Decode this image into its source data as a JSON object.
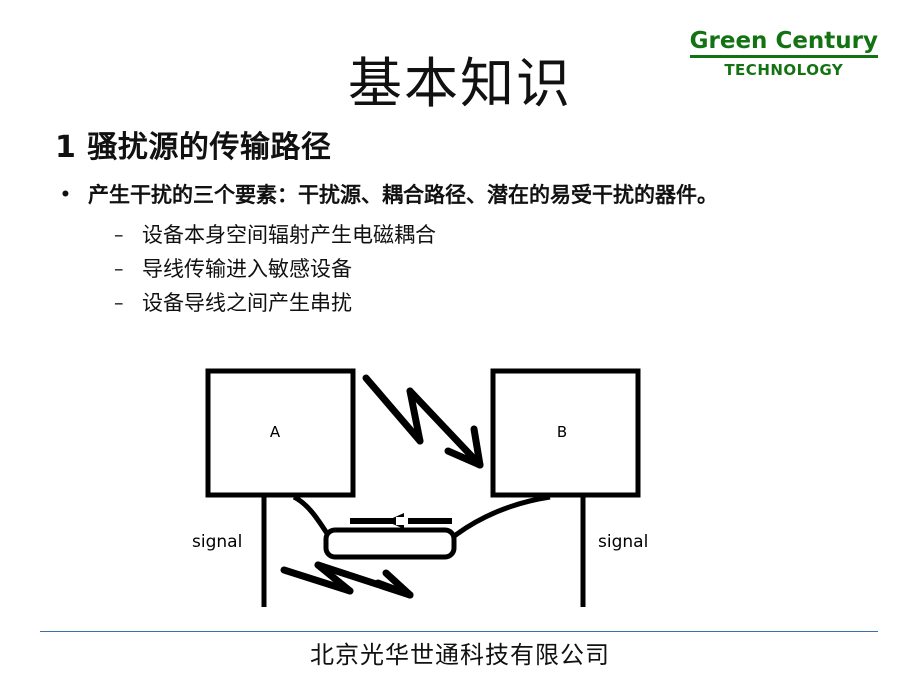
{
  "logo": {
    "main": "Green Century",
    "sub": "TECHNOLOGY",
    "color": "#137312"
  },
  "title": "基本知识",
  "sub_heading": "1 骚扰源的传输路径",
  "bullets": [
    {
      "marker": "•",
      "text": "产生干扰的三个要素：干扰源、耦合路径、潜在的易受干扰的器件。"
    }
  ],
  "sub_bullets": [
    {
      "marker": "–",
      "text": "设备本身空间辐射产生电磁耦合"
    },
    {
      "marker": "–",
      "text": "导线传输进入敏感设备"
    },
    {
      "marker": "–",
      "text": "设备导线之间产生串扰"
    }
  ],
  "diagram": {
    "box_a_label": "A",
    "box_b_label": "B",
    "signal_left_label": "signal",
    "signal_right_label": "signal",
    "stroke_color": "#000000"
  },
  "footer": {
    "text": "北京光华世通科技有限公司",
    "rule_color": "#3A6FA8"
  }
}
